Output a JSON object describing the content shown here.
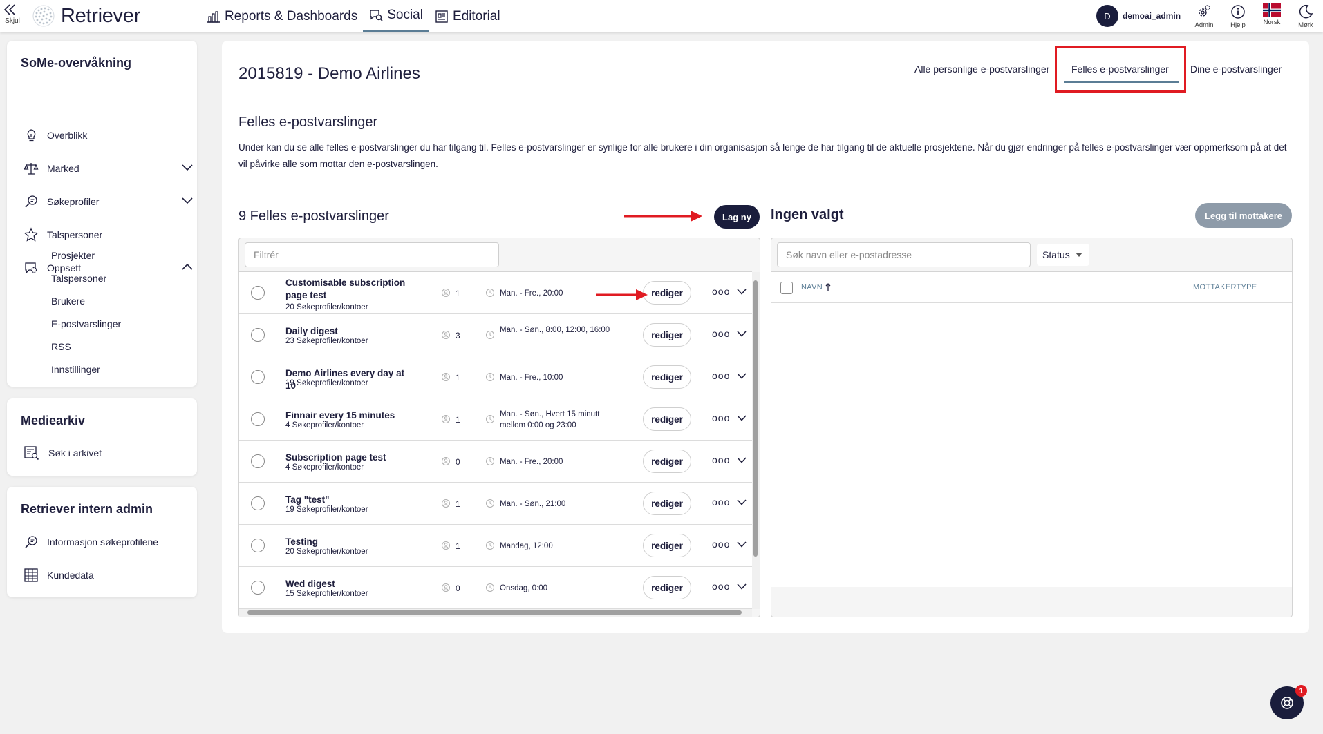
{
  "topbar": {
    "hide_label": "Skjul",
    "brand": "Retriever",
    "nav": [
      {
        "label": "Reports & Dashboards",
        "icon": "chart-icon"
      },
      {
        "label": "Social",
        "icon": "chat-search-icon",
        "active": true
      },
      {
        "label": "Editorial",
        "icon": "newspaper-icon"
      }
    ],
    "user": {
      "initial": "D",
      "name": "demoai_admin"
    },
    "icons": [
      {
        "label": "Admin",
        "icon": "gear-icon"
      },
      {
        "label": "Hjelp",
        "icon": "info-icon"
      },
      {
        "label": "Norsk",
        "icon": "norway-flag-icon"
      },
      {
        "label": "Mørk",
        "icon": "moon-icon"
      }
    ]
  },
  "sidebar": {
    "some": {
      "title": "SoMe-overvåkning",
      "items": [
        {
          "label": "Overblikk",
          "icon": "lightbulb-icon"
        },
        {
          "label": "Marked",
          "icon": "scale-icon",
          "expanded": false
        },
        {
          "label": "Søkeprofiler",
          "icon": "search-chat-icon",
          "expanded": false
        },
        {
          "label": "Talspersoner",
          "icon": "star-icon"
        },
        {
          "label": "Oppsett",
          "icon": "settings-chat-icon",
          "expanded": true
        }
      ],
      "subitems": [
        "Prosjekter",
        "Talspersoner",
        "Brukere",
        "E-postvarslinger",
        "RSS",
        "Innstillinger"
      ]
    },
    "archive": {
      "title": "Mediearkiv",
      "items": [
        {
          "label": "Søk i arkivet",
          "icon": "archive-search-icon"
        }
      ]
    },
    "internal": {
      "title": "Retriever intern admin",
      "items": [
        {
          "label": "Informasjon søkeprofilene",
          "icon": "search-chat-icon"
        },
        {
          "label": "Kundedata",
          "icon": "table-icon"
        }
      ]
    }
  },
  "main": {
    "title": "2015819 - Demo Airlines",
    "tabs": [
      {
        "label": "Alle personlige e-postvarslinger"
      },
      {
        "label": "Felles e-postvarslinger",
        "active": true
      },
      {
        "label": "Dine e-postvarslinger"
      }
    ],
    "section_title": "Felles e-postvarslinger",
    "description": "Under kan du se alle felles e-postvarslinger du har tilgang til. Felles e-postvarslinger er synlige for alle brukere i din organisasjon så lenge de har tilgang til de aktuelle prosjektene. Når du gjør endringer på felles e-postvarslinger vær oppmerksom på at det vil påvirke alle som mottar den e-postvarslingen.",
    "list_title": "9 Felles e-postvarslinger",
    "new_button": "Lag ny",
    "filter_placeholder": "Filtrér",
    "edit_label": "rediger",
    "more_label": "ooo",
    "alerts": [
      {
        "title": "Customisable subscription page test",
        "sub": "20 Søkeprofiler/kontoer",
        "count": "1",
        "schedule": "Man. - Fre., 20:00"
      },
      {
        "title": "Daily digest",
        "sub": "23 Søkeprofiler/kontoer",
        "count": "3",
        "schedule": "Man. - Søn., 8:00, 12:00, 16:00"
      },
      {
        "title": "Demo Airlines every day at 10",
        "sub": "19 Søkeprofiler/kontoer",
        "count": "1",
        "schedule": "Man. - Fre., 10:00"
      },
      {
        "title": "Finnair every 15 minutes",
        "sub": "4 Søkeprofiler/kontoer",
        "count": "1",
        "schedule": "Man. - Søn., Hvert 15 minutt mellom 0:00 og 23:00"
      },
      {
        "title": "Subscription page test",
        "sub": "4 Søkeprofiler/kontoer",
        "count": "0",
        "schedule": "Man. - Fre., 20:00"
      },
      {
        "title": "Tag \"test\"",
        "sub": "19 Søkeprofiler/kontoer",
        "count": "1",
        "schedule": "Man. - Søn., 21:00"
      },
      {
        "title": "Testing",
        "sub": "20 Søkeprofiler/kontoer",
        "count": "1",
        "schedule": "Mandag, 12:00"
      },
      {
        "title": "Wed digest",
        "sub": "15 Søkeprofiler/kontoer",
        "count": "0",
        "schedule": "Onsdag, 0:00"
      }
    ]
  },
  "recipients": {
    "title": "Ingen valgt",
    "add_button": "Legg til mottakere",
    "search_placeholder": "Søk navn eller e-postadresse",
    "status_label": "Status",
    "col_name": "NAVN",
    "col_type": "MOTTAKERTYPE"
  },
  "fab": {
    "badge": "1",
    "icon": "help-wheel-icon"
  },
  "colors": {
    "navy": "#1a1d3c",
    "accent": "#5b7d95",
    "highlight": "#e01b22"
  }
}
